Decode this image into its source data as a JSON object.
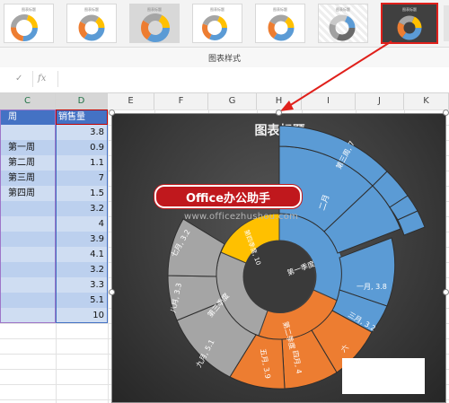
{
  "ribbon": {
    "group_label": "图表样式",
    "thumbnails": [
      {
        "title": "图表标题",
        "selected": false
      },
      {
        "title": "图表标题",
        "selected": false
      },
      {
        "title": "图表标题",
        "selected": false
      },
      {
        "title": "图表标题",
        "selected": false
      },
      {
        "title": "图表标题",
        "selected": false
      },
      {
        "title": "图表标题",
        "selected": false
      },
      {
        "title": "图表标题",
        "selected": true
      }
    ]
  },
  "formula_bar": {
    "check_glyph": "✓",
    "fx_glyph": "fx",
    "value": ""
  },
  "columns": [
    "C",
    "D",
    "E",
    "F",
    "G",
    "H",
    "I",
    "J",
    "K"
  ],
  "sheet": {
    "header": {
      "c": "周",
      "d": "销售量"
    },
    "rows": [
      {
        "c": "",
        "d": "3.8"
      },
      {
        "c": "第一周",
        "d": "0.9"
      },
      {
        "c": "第二周",
        "d": "1.1"
      },
      {
        "c": "第三周",
        "d": "7"
      },
      {
        "c": "第四周",
        "d": "1.5"
      },
      {
        "c": "",
        "d": "3.2"
      },
      {
        "c": "",
        "d": "4"
      },
      {
        "c": "",
        "d": "3.9"
      },
      {
        "c": "",
        "d": "4.1"
      },
      {
        "c": "",
        "d": "3.2"
      },
      {
        "c": "",
        "d": "3.3"
      },
      {
        "c": "",
        "d": "5.1"
      },
      {
        "c": "",
        "d": "10"
      }
    ]
  },
  "chart": {
    "title": "图表标题",
    "colors": {
      "q1": "#5b9bd5",
      "q2": "#ed7d31",
      "q3": "#a5a5a5",
      "q4": "#ffc000",
      "arrow": "#e0201b"
    },
    "inner_labels": {
      "q1": "第一季度",
      "q2": "第二季度",
      "q3": "第三季度",
      "q4": "第四季度, 10"
    },
    "outer_labels": {
      "feb": "二月",
      "jan": "一月, 3.8",
      "mar": "三月, 3.2",
      "apr": "四月, 4",
      "may": "五月, 3.9",
      "jun": "六",
      "jul": "七月, 3.2",
      "aug": "八月, 3.3",
      "sep": "九月, 5.1",
      "week3": "第三周, 7"
    }
  },
  "watermark": {
    "badge": "Office办公助手",
    "url": "www.officezhushou.com"
  }
}
